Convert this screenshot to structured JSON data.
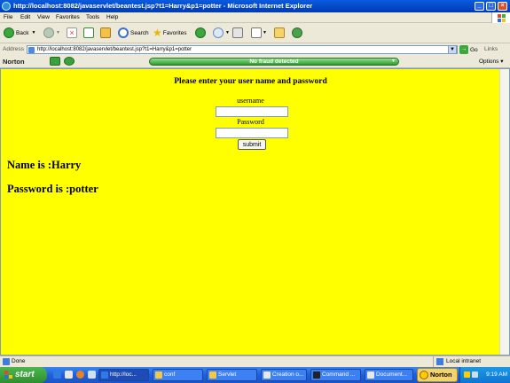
{
  "window": {
    "title": "http://localhost:8082/javaservlet/beantest.jsp?t1=Harry&p1=potter - Microsoft Internet Explorer",
    "min_glyph": "_",
    "max_glyph": "□",
    "close_glyph": "×"
  },
  "menu": [
    "File",
    "Edit",
    "View",
    "Favorites",
    "Tools",
    "Help"
  ],
  "toolbar": {
    "back_label": "Back",
    "search_label": "Search",
    "favorites_label": "Favorites"
  },
  "address": {
    "label": "Address",
    "url": "http://localhost:8082/javaservlet/beantest.jsp?t1=Harry&p1=potter",
    "go_label": "Go",
    "links_label": "Links"
  },
  "norton_bar": {
    "logo": "Norton",
    "status": "No fraud detected",
    "options_label": "Options"
  },
  "page": {
    "heading": "Please enter your user name and password",
    "username_label": "username",
    "username_value": "",
    "password_label": "Password",
    "password_value": "",
    "submit_label": "submit",
    "name_result": "Name is :Harry",
    "password_result": "Password is :potter"
  },
  "statusbar": {
    "status": "Done",
    "zone": "Local intranet"
  },
  "taskbar": {
    "start_label": "start",
    "tasks": [
      {
        "label": "http://loc...",
        "active": true,
        "color": "#2f7ae6"
      },
      {
        "label": "conf",
        "active": false,
        "color": "#f3c843"
      },
      {
        "label": "Servlet",
        "active": false,
        "color": "#f3c843"
      },
      {
        "label": "Creation o...",
        "active": false,
        "color": "#e8e8e8"
      },
      {
        "label": "Command ...",
        "active": false,
        "color": "#222222"
      },
      {
        "label": "Document...",
        "active": false,
        "color": "#e8e8e8"
      }
    ],
    "norton_label": "Norton",
    "clock": "9:19 AM"
  }
}
